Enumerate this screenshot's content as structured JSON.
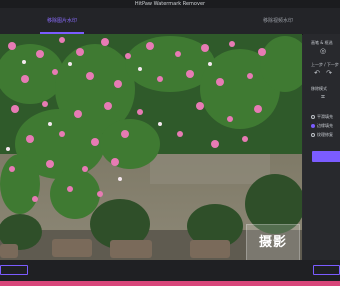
{
  "window": {
    "title": "HitPaw Watermark Remover"
  },
  "tabs": [
    {
      "label": "移除图片水印",
      "active": true
    },
    {
      "label": "移除视频水印",
      "active": false
    }
  ],
  "sidebar": {
    "items": [
      {
        "label": "画笔 & 框选"
      },
      {
        "label": "上一步 / 下一步"
      },
      {
        "label": "移除模式"
      }
    ],
    "modes": [
      {
        "label": "平滑填充",
        "checked": false
      },
      {
        "label": "边缘填充",
        "checked": true
      },
      {
        "label": "纹理修复",
        "checked": false
      }
    ]
  },
  "canvas": {
    "watermark_text": "摄影"
  },
  "colors": {
    "accent": "#7b5cff",
    "background": "#2a2b2f",
    "dock": "#d8467a"
  }
}
